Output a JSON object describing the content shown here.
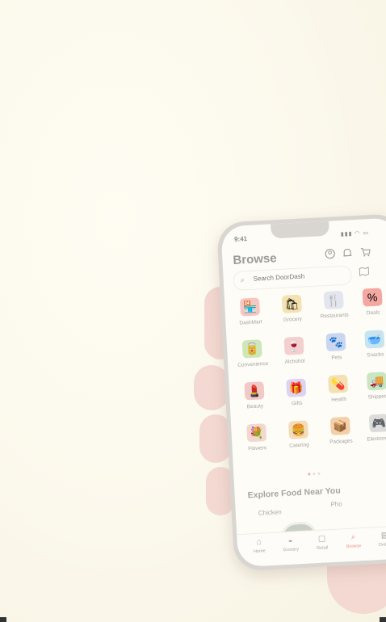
{
  "status": {
    "time": "9:41",
    "icons": "▮▮▮ ◠ ▭"
  },
  "header": {
    "title": "Browse",
    "profile_icon": "profile-icon",
    "bell_icon": "bell-icon",
    "cart_icon": "cart-icon"
  },
  "search": {
    "placeholder": "Search DoorDash",
    "icon": "search-icon",
    "map_icon": "map-icon"
  },
  "categories": [
    {
      "label": "DashMart",
      "icon": "🏪",
      "color": "#f6c6c2"
    },
    {
      "label": "Grocery",
      "icon": "🛍",
      "color": "#f4e2b0"
    },
    {
      "label": "Restaurants",
      "icon": "🍴",
      "color": "#e3e6ee"
    },
    {
      "label": "Deals",
      "icon": "%",
      "color": "#f5a8a2"
    },
    {
      "label": "Convenience",
      "icon": "🥫",
      "color": "#cfe6b8"
    },
    {
      "label": "Alchohol",
      "icon": "🍷",
      "color": "#f4cfcf"
    },
    {
      "label": "Pets",
      "icon": "🐾",
      "color": "#c8d6f0"
    },
    {
      "label": "Snacks",
      "icon": "🥣",
      "color": "#c7e4f0"
    },
    {
      "label": "Beauty",
      "icon": "💄",
      "color": "#f1c9c6"
    },
    {
      "label": "Gifts",
      "icon": "🎁",
      "color": "#ddd2f2"
    },
    {
      "label": "Health",
      "icon": "💊",
      "color": "#f4e1b3"
    },
    {
      "label": "Shipped",
      "icon": "🚚",
      "color": "#c8e6bf"
    },
    {
      "label": "Flowers",
      "icon": "💐",
      "color": "#f2d9d0"
    },
    {
      "label": "Catering",
      "icon": "🍔",
      "color": "#f3ddb8"
    },
    {
      "label": "Packages",
      "icon": "📦",
      "color": "#f4cfa8"
    },
    {
      "label": "Electronics",
      "icon": "🎮",
      "color": "#dcdcdc"
    }
  ],
  "pager": {
    "count": 3,
    "active": 0
  },
  "explore": {
    "title": "Explore Food Near You",
    "items": [
      "Chicken",
      "Pho"
    ]
  },
  "tabs": [
    {
      "label": "Home",
      "icon": "⌂"
    },
    {
      "label": "Grocery",
      "icon": "◒"
    },
    {
      "label": "Retail",
      "icon": "▢"
    },
    {
      "label": "Browse",
      "icon": "⌕"
    },
    {
      "label": "Orders",
      "icon": "▤"
    }
  ],
  "active_tab": 3,
  "colors": {
    "accent": "#f08c8a",
    "background": "#fbf9ee"
  }
}
